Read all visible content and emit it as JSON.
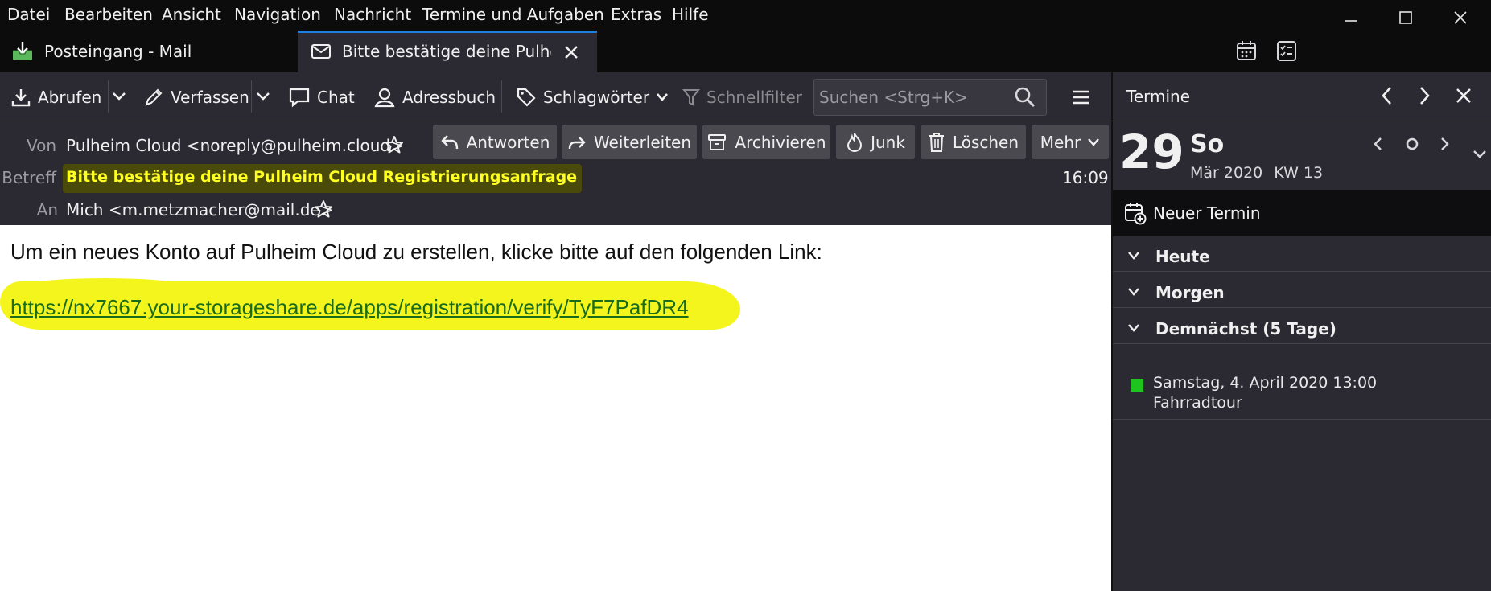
{
  "menubar": {
    "items": [
      "Datei",
      "Bearbeiten",
      "Ansicht",
      "Navigation",
      "Nachricht",
      "Termine und Aufgaben",
      "Extras",
      "Hilfe"
    ]
  },
  "tabs": [
    {
      "label": "Posteingang - Mail",
      "icon": "inbox-download-icon",
      "active": false
    },
    {
      "label": "Bitte bestätige deine Pulheim",
      "icon": "envelope-icon",
      "active": true
    }
  ],
  "toolbar": {
    "abrufen": "Abrufen",
    "verfassen": "Verfassen",
    "chat": "Chat",
    "adressbuch": "Adressbuch",
    "schlagwoerter": "Schlagwörter",
    "schnellfilter": "Schnellfilter",
    "search_placeholder": "Suchen <Strg+K>"
  },
  "header": {
    "from_label": "Von",
    "from_value": "Pulheim Cloud <noreply@pulheim.cloud>",
    "subject_label": "Betreff",
    "subject_value": "Bitte bestätige deine Pulheim Cloud Registrierungsanfrage",
    "time": "16:09",
    "to_label": "An",
    "to_value": "Mich <m.metzmacher@mail.de>",
    "buttons": {
      "reply": "Antworten",
      "forward": "Weiterleiten",
      "archive": "Archivieren",
      "junk": "Junk",
      "delete": "Löschen",
      "more": "Mehr"
    }
  },
  "body": {
    "text": "Um ein neues Konto auf Pulheim Cloud zu erstellen, klicke bitte auf den folgenden Link:",
    "link": "https://nx7667.your-storageshare.de/apps/registration/verify/TyF7PafDR4",
    "highlight_color": "#f5f51e"
  },
  "calendar": {
    "title": "Termine",
    "day_number": "29",
    "day_name": "So",
    "month_year": "Mär 2020",
    "week": "KW 13",
    "new_event": "Neuer Termin",
    "sections": [
      "Heute",
      "Morgen",
      "Demnächst (5 Tage)"
    ],
    "events": [
      {
        "date": "Samstag, 4. April 2020 13:00",
        "title": "Fahrradtour",
        "color": "#1ec51e"
      }
    ]
  }
}
